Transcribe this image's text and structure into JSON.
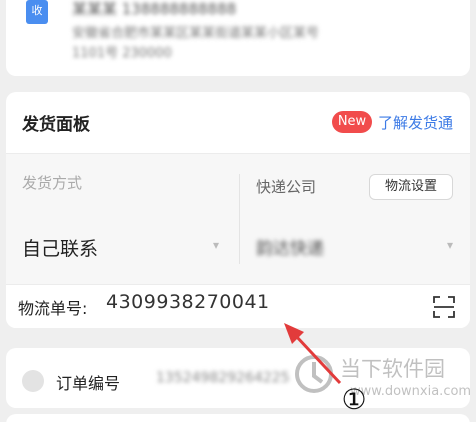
{
  "address": {
    "icon": "location-icon",
    "icon_text": "收",
    "name_line": "某某某 138888888888",
    "line1": "安徽省合肥市某某区某某街道某某小区某号",
    "line2": "1101号 230000"
  },
  "shipping_panel": {
    "title": "发货面板",
    "badge": "New",
    "learn_link": "了解发货通",
    "method_label": "发货方式",
    "method_value": "自己联系",
    "courier_label": "快递公司",
    "settings_button": "物流设置",
    "courier_value": "韵达快递",
    "tracking_label": "物流单号:",
    "tracking_value": "4309938270041",
    "scan_icon": "scan-icon"
  },
  "order": {
    "label": "订单编号",
    "number": "135249829264225"
  },
  "annotation": {
    "number": "①",
    "arrow_color": "#e23b3b"
  },
  "watermark": {
    "text": "当下软件园",
    "url": "www.downxia.com"
  },
  "colors": {
    "accent_blue": "#3d7be6",
    "badge_red": "#f14c4c"
  }
}
